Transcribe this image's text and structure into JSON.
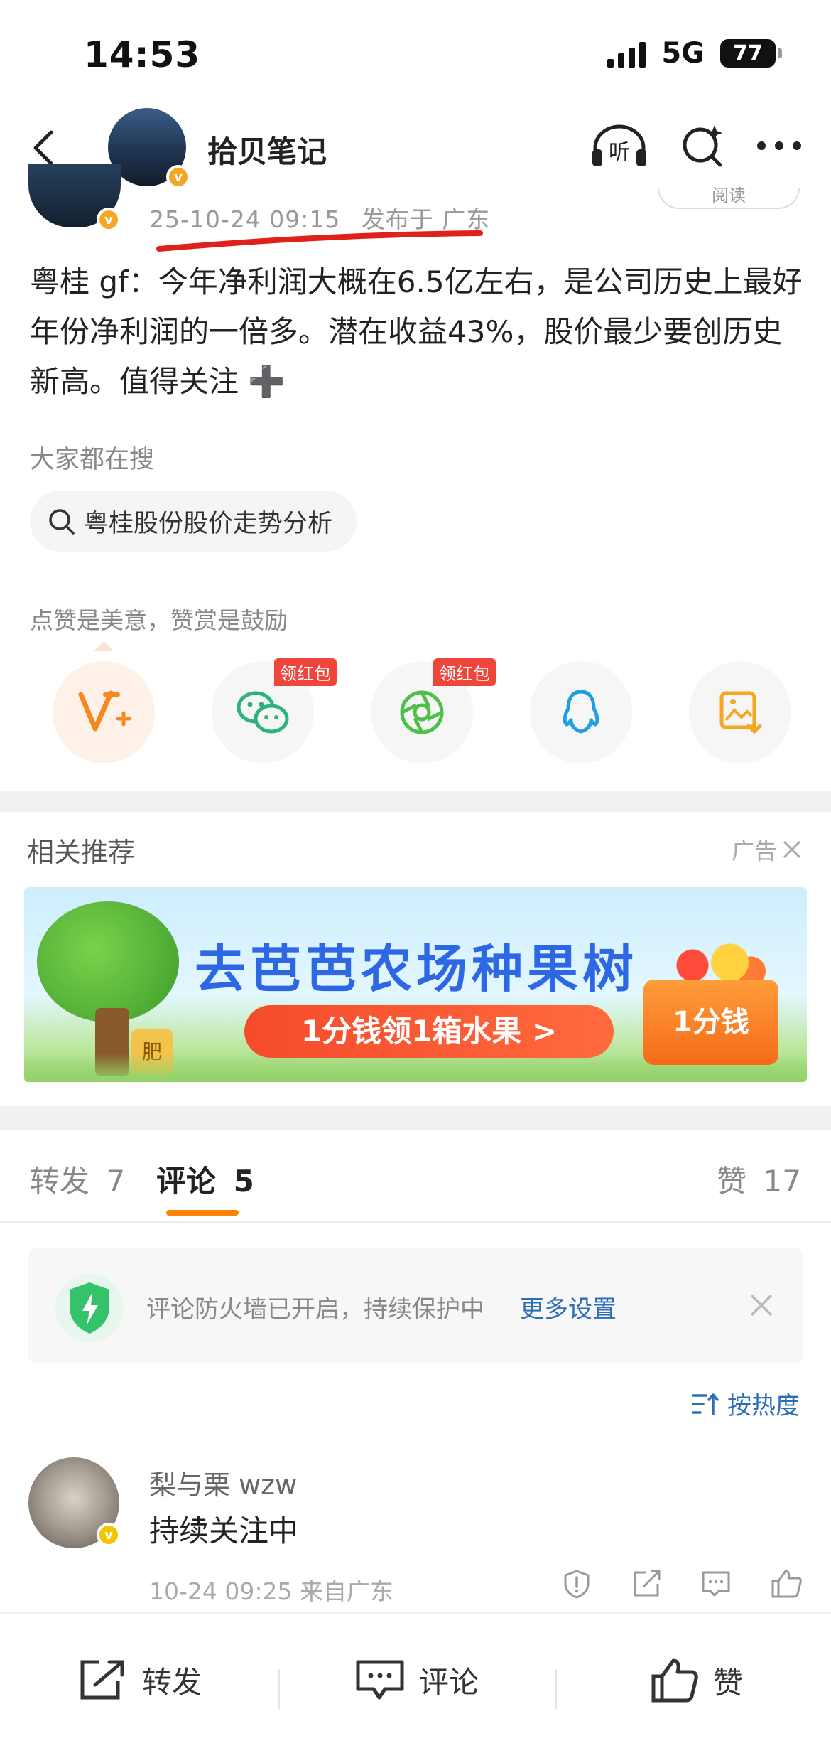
{
  "status_bar": {
    "time": "14:53",
    "network": "5G",
    "battery": "77"
  },
  "nav": {
    "title": "拾贝笔记"
  },
  "post": {
    "read_label": "阅读",
    "timestamp": "25-10-24 09:15",
    "location": "发布于 广东",
    "content": "粤桂 gf：今年净利润大概在6.5亿左右，是公司历史上最好年份净利润的一倍多。潜在收益43%，股价最少要创历史新高。值得关注 ➕"
  },
  "search": {
    "heading": "大家都在搜",
    "chip": "粤桂股份股价走势分析"
  },
  "reward": {
    "caption": "点赞是美意，赞赏是鼓励"
  },
  "share": {
    "items": [
      {
        "icon": "v-plus-icon"
      },
      {
        "icon": "wechat-icon",
        "tag": "领红包"
      },
      {
        "icon": "moments-icon",
        "tag": "领红包"
      },
      {
        "icon": "qq-icon"
      },
      {
        "icon": "save-image-icon"
      }
    ]
  },
  "recommend": {
    "title": "相关推荐",
    "ad_label": "广告"
  },
  "banner": {
    "headline": "去芭芭农场种果树",
    "cta": "1分钱领1箱水果 >",
    "box_text": "1分钱",
    "bag_text": "肥"
  },
  "tabs": {
    "repost": "转发",
    "repost_count": "7",
    "comment": "评论",
    "comment_count": "5",
    "like": "赞",
    "like_count": "17"
  },
  "firewall": {
    "text": "评论防火墙已开启，持续保护中",
    "link": "更多设置"
  },
  "sort": {
    "label": "按热度"
  },
  "comment": {
    "name": "梨与栗 wzw",
    "text": "持续关注中",
    "meta": "10-24 09:25 来自广东"
  },
  "bottom_bar": {
    "repost": "转发",
    "comment": "评论",
    "like": "赞"
  },
  "colors": {
    "accent_orange": "#ff8200",
    "link_blue": "#2d6fb6",
    "tag_red": "#f0453a",
    "underline_red": "#e0201b"
  }
}
